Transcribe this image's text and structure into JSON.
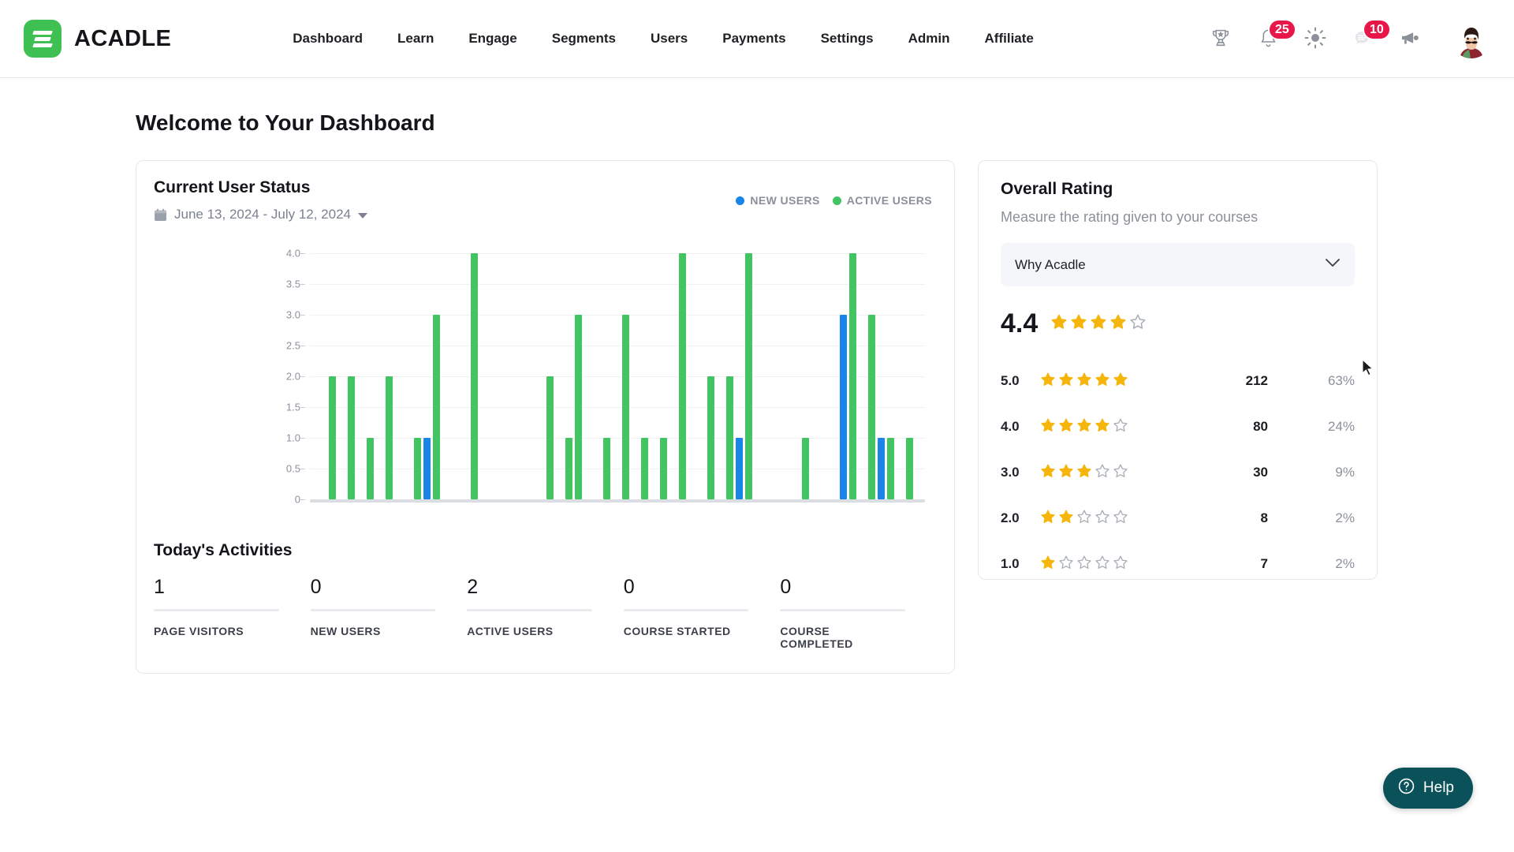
{
  "brand": {
    "name": "ACADLE",
    "logo_icon": "acadle-logo-icon",
    "accent": "#3ec152"
  },
  "nav": {
    "items": [
      {
        "label": "Dashboard"
      },
      {
        "label": "Learn"
      },
      {
        "label": "Engage"
      },
      {
        "label": "Segments"
      },
      {
        "label": "Users"
      },
      {
        "label": "Payments"
      },
      {
        "label": "Settings"
      },
      {
        "label": "Admin"
      },
      {
        "label": "Affiliate"
      }
    ],
    "tools": [
      {
        "icon": "trophy-icon",
        "badge": ""
      },
      {
        "icon": "bell-icon",
        "badge": "25"
      },
      {
        "icon": "brightness-sun-icon",
        "badge": ""
      },
      {
        "icon": "chat-bubble-icon",
        "badge": "10"
      },
      {
        "icon": "megaphone-icon",
        "badge": ""
      }
    ],
    "avatar": "user-avatar",
    "badge_color": "#e8174a"
  },
  "page": {
    "title": "Welcome to Your Dashboard"
  },
  "user_status_card": {
    "title": "Current User Status",
    "date_range": "June 13, 2024 - July 12, 2024",
    "calendar_icon": "calendar-icon",
    "dropdown_icon": "caret-down-icon",
    "legend": [
      {
        "label": "NEW USERS",
        "color": "#1a85e8"
      },
      {
        "label": "ACTIVE USERS",
        "color": "#43c463"
      }
    ]
  },
  "chart_data": {
    "type": "bar",
    "title": "Current User Status",
    "xlabel": "",
    "ylabel": "",
    "ylim": [
      0,
      4
    ],
    "yticks": [
      "0",
      "0.5",
      "1.0",
      "1.5",
      "2.0",
      "2.5",
      "3.0",
      "3.5",
      "4.0"
    ],
    "grid": true,
    "legend_position": "top-right",
    "series": [
      {
        "name": "ACTIVE USERS",
        "color": "#43c463",
        "points": [
          {
            "x": 2,
            "y": 2
          },
          {
            "x": 4,
            "y": 2
          },
          {
            "x": 6,
            "y": 1
          },
          {
            "x": 8,
            "y": 2
          },
          {
            "x": 11,
            "y": 1
          },
          {
            "x": 13,
            "y": 3
          },
          {
            "x": 17,
            "y": 4
          },
          {
            "x": 25,
            "y": 2
          },
          {
            "x": 27,
            "y": 1
          },
          {
            "x": 28,
            "y": 3
          },
          {
            "x": 31,
            "y": 1
          },
          {
            "x": 33,
            "y": 3
          },
          {
            "x": 35,
            "y": 1
          },
          {
            "x": 37,
            "y": 1
          },
          {
            "x": 39,
            "y": 4
          },
          {
            "x": 42,
            "y": 2
          },
          {
            "x": 44,
            "y": 2
          },
          {
            "x": 46,
            "y": 4
          },
          {
            "x": 52,
            "y": 1
          },
          {
            "x": 57,
            "y": 4
          },
          {
            "x": 59,
            "y": 3
          },
          {
            "x": 61,
            "y": 1
          },
          {
            "x": 63,
            "y": 1
          }
        ]
      },
      {
        "name": "NEW USERS",
        "color": "#1a85e8",
        "points": [
          {
            "x": 12,
            "y": 1
          },
          {
            "x": 45,
            "y": 1
          },
          {
            "x": 56,
            "y": 3
          },
          {
            "x": 60,
            "y": 1
          }
        ]
      }
    ]
  },
  "todays_activities": {
    "title": "Today's Activities",
    "metrics": [
      {
        "value": "1",
        "label": "PAGE VISITORS"
      },
      {
        "value": "0",
        "label": "NEW USERS"
      },
      {
        "value": "2",
        "label": "ACTIVE USERS"
      },
      {
        "value": "0",
        "label": "COURSE STARTED"
      },
      {
        "value": "0",
        "label": "COURSE COMPLETED"
      }
    ]
  },
  "overall_rating": {
    "title": "Overall Rating",
    "subtitle": "Measure the rating given to your courses",
    "course_select": {
      "value": "Why Acadle",
      "icon": "chevron-down-icon"
    },
    "average": "4.4",
    "average_filled_stars": 4,
    "star_color": "#f5b50a",
    "rows": [
      {
        "score": "5.0",
        "filled": 5,
        "count": "212",
        "percent": "63%"
      },
      {
        "score": "4.0",
        "filled": 4,
        "count": "80",
        "percent": "24%"
      },
      {
        "score": "3.0",
        "filled": 3,
        "count": "30",
        "percent": "9%"
      },
      {
        "score": "2.0",
        "filled": 2,
        "count": "8",
        "percent": "2%"
      },
      {
        "score": "1.0",
        "filled": 1,
        "count": "7",
        "percent": "2%"
      }
    ]
  },
  "help": {
    "label": "Help",
    "icon": "question-circle-icon",
    "color": "#0b5159"
  }
}
